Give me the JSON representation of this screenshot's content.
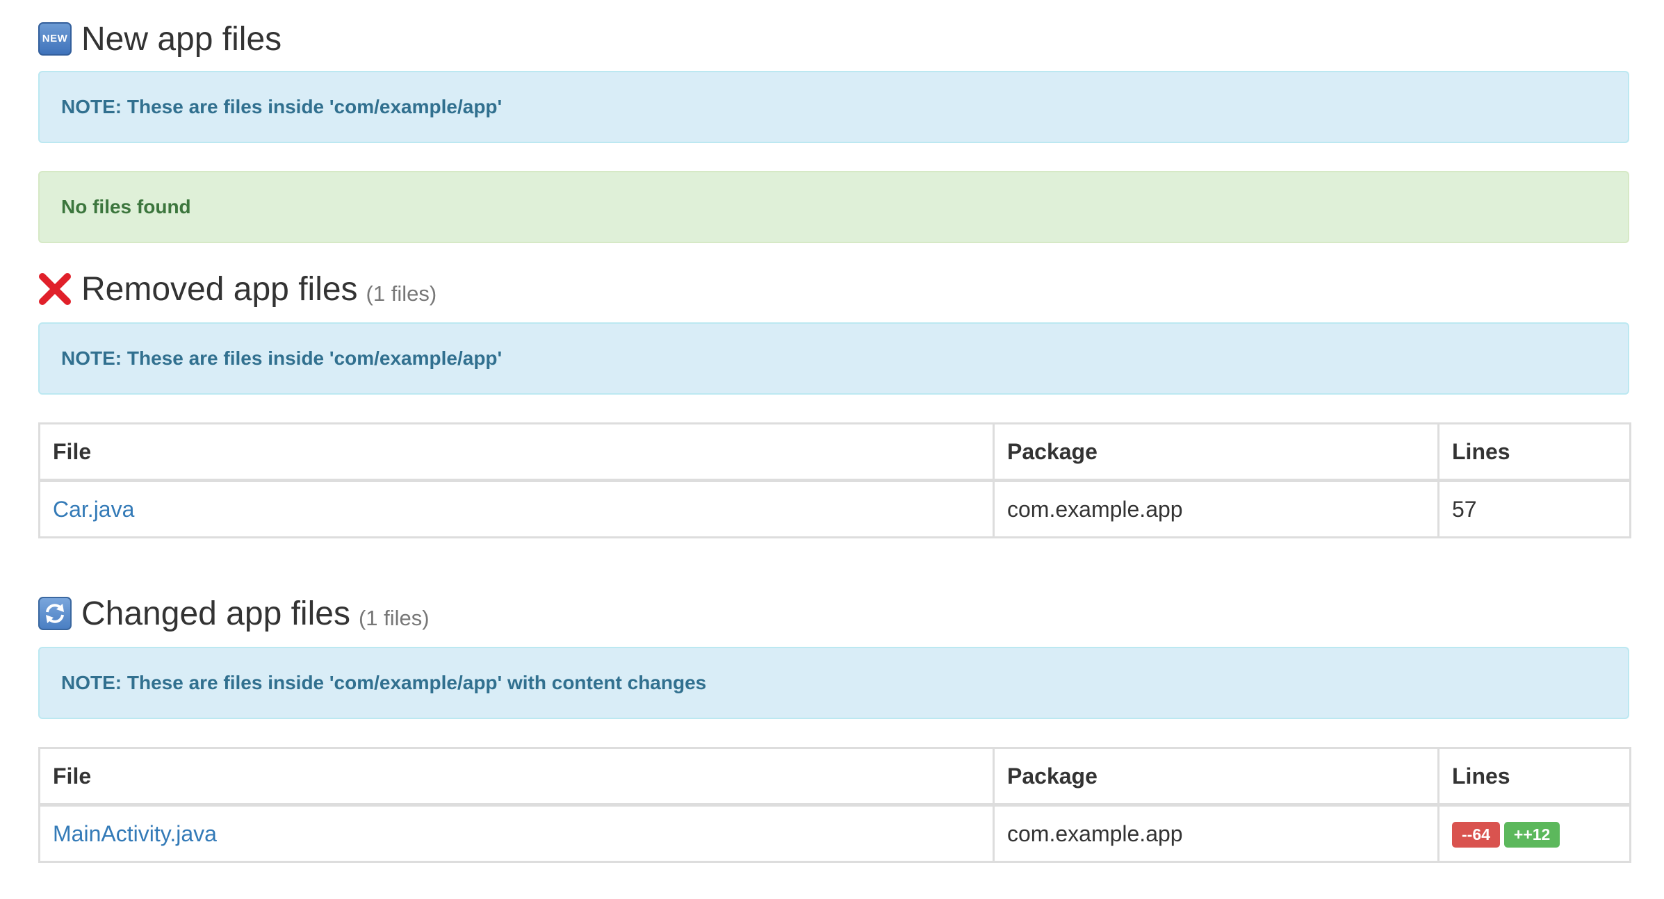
{
  "colors": {
    "info_bg": "#d9edf7",
    "info_text": "#31708f",
    "success_bg": "#dff0d8",
    "success_text": "#3c763d",
    "link": "#337ab7",
    "removed_badge": "#d9534f",
    "added_badge": "#5cb85c",
    "removed_icon": "#e0202a"
  },
  "new_section": {
    "icon": "new-icon",
    "icon_text": "NEW",
    "title": "New app files",
    "note": "NOTE: These are files inside 'com/example/app'",
    "empty_message": "No files found"
  },
  "removed_section": {
    "icon": "cross-mark-icon",
    "title": "Removed app files",
    "count": "(1 files)",
    "note": "NOTE: These are files inside 'com/example/app'",
    "columns": [
      "File",
      "Package",
      "Lines"
    ],
    "rows": [
      {
        "file": "Car.java",
        "package": "com.example.app",
        "lines": "57"
      }
    ]
  },
  "changed_section": {
    "icon": "refresh-icon",
    "title": "Changed app files",
    "count": "(1 files)",
    "note": "NOTE: These are files inside 'com/example/app' with content changes",
    "columns": [
      "File",
      "Package",
      "Lines"
    ],
    "rows": [
      {
        "file": "MainActivity.java",
        "package": "com.example.app",
        "removed": "--64",
        "added": "++12"
      }
    ]
  }
}
